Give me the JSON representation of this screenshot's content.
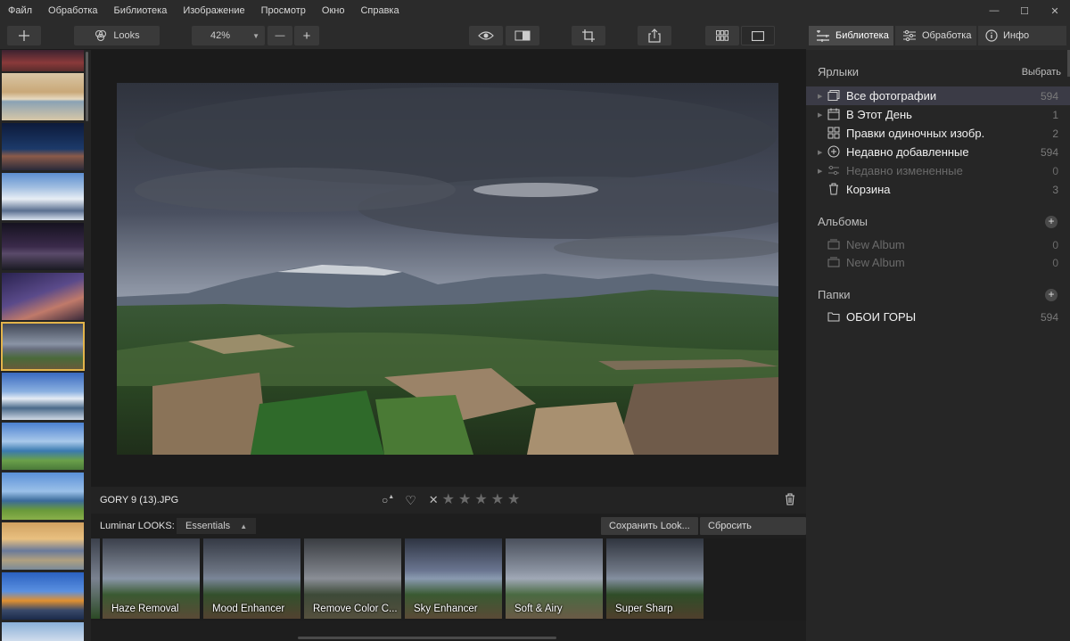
{
  "menu": [
    "Файл",
    "Обработка",
    "Библиотека",
    "Изображение",
    "Просмотр",
    "Окно",
    "Справка"
  ],
  "window_controls": {
    "minimize": "—",
    "maximize": "☐",
    "close": "✕"
  },
  "toolbar": {
    "add_icon": "plus-icon",
    "looks_label": "Looks",
    "zoom_value": "42%",
    "zoom_minus": "—",
    "zoom_plus": "+"
  },
  "panel_tabs": {
    "library": "Библиотека",
    "edit": "Обработка",
    "info": "Инфо"
  },
  "shortcuts": {
    "title": "Ярлыки",
    "action": "Выбрать",
    "items": [
      {
        "label": "Все фотографии",
        "count": "594",
        "icon": "photos-icon",
        "active": true,
        "dim": false
      },
      {
        "label": "В Этот День",
        "count": "1",
        "icon": "calendar-icon",
        "active": false,
        "dim": false
      },
      {
        "label": "Правки одиночных изобр.",
        "count": "2",
        "icon": "grid-icon",
        "active": false,
        "dim": false
      },
      {
        "label": "Недавно добавленные",
        "count": "594",
        "icon": "add-circle-icon",
        "active": false,
        "dim": false
      },
      {
        "label": "Недавно измененные",
        "count": "0",
        "icon": "sliders-icon",
        "active": false,
        "dim": true
      },
      {
        "label": "Корзина",
        "count": "3",
        "icon": "trash-icon",
        "active": false,
        "dim": false
      }
    ]
  },
  "albums": {
    "title": "Альбомы",
    "items": [
      {
        "label": "New Album",
        "count": "0"
      },
      {
        "label": "New Album",
        "count": "0"
      }
    ]
  },
  "folders": {
    "title": "Папки",
    "items": [
      {
        "label": "ОБОИ ГОРЫ",
        "count": "594"
      }
    ]
  },
  "image": {
    "filename": "GORY 9 (13).JPG",
    "rating_stars": 0,
    "rating_max": 5
  },
  "looks": {
    "label": "Luminar LOOKS:",
    "category": "Essentials",
    "save_button": "Сохранить Look...",
    "reset_button": "Сбросить настройки",
    "presets": [
      "Haze Removal",
      "Mood Enhancer",
      "Remove Color C...",
      "Sky Enhancer",
      "Soft & Airy",
      "Super Sharp"
    ]
  },
  "colors": {
    "accent_selected": "#e3b44a",
    "active_row": "#3b3b46"
  }
}
